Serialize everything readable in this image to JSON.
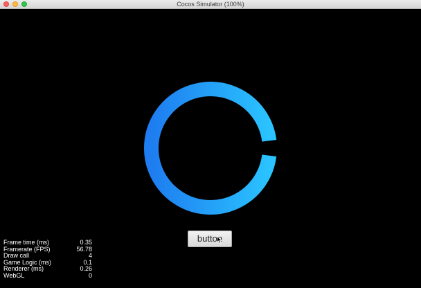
{
  "window": {
    "title": "Cocos Simulator (100%)"
  },
  "scene": {
    "progress_ring": {
      "progress": 0.96,
      "color_start": "#1e7df0",
      "color_end": "#2ac3ff"
    },
    "button": {
      "label": "button"
    }
  },
  "stats": [
    {
      "label": "Frame time (ms)",
      "value": "0.35"
    },
    {
      "label": "Framerate (FPS)",
      "value": "56.78"
    },
    {
      "label": "Draw call",
      "value": "4"
    },
    {
      "label": "Game Logic (ms)",
      "value": "0.1"
    },
    {
      "label": "Renderer (ms)",
      "value": "0.26"
    },
    {
      "label": "WebGL",
      "value": "0"
    }
  ],
  "colors": {
    "background": "#000000",
    "stats_text": "#ffffff"
  }
}
